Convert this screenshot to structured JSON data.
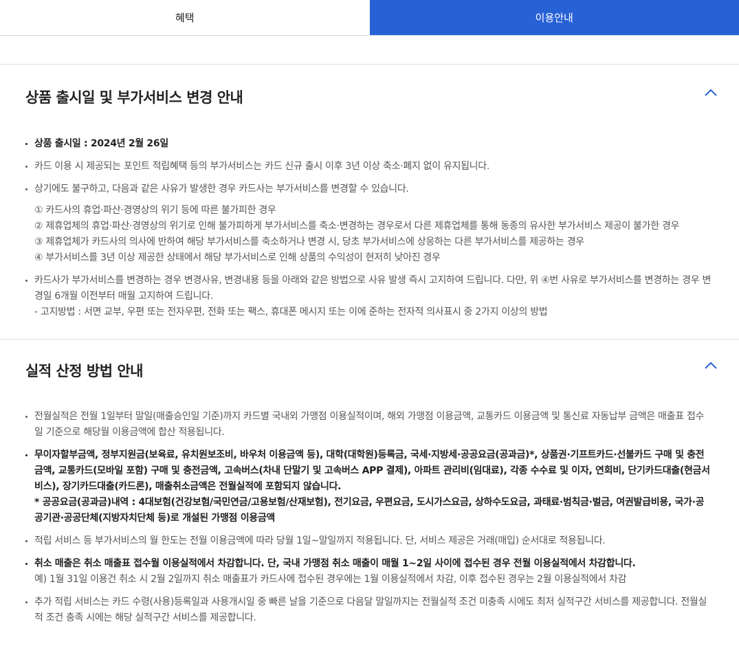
{
  "tabs": [
    {
      "label": "혜택",
      "active": false
    },
    {
      "label": "이용안내",
      "active": true
    }
  ],
  "colors": {
    "accent": "#2761d6",
    "chevron": "#2761d6"
  },
  "sections": [
    {
      "title": "상품 출시일 및 부가서비스 변경 안내",
      "toggle_icon": "chevron-up-icon",
      "items": [
        {
          "text": "상품 출시일 : 2024년 2월 26일"
        },
        {
          "text": "카드 이용 시 제공되는 포인트 적립혜택 등의 부가서비스는 카드 신규 출시 이후 3년 이상 축소·폐지 없이 유지됩니다."
        },
        {
          "text": "상기에도 불구하고, 다음과 같은 사유가 발생한 경우 카드사는 부가서비스를 변경할 수 있습니다.",
          "sub": [
            "① 카드사의 휴업·파산·경영상의 위기 등에 따른 불가피한 경우",
            "② 제휴업체의 휴업·파산·경영상의 위기로 인해 불가피하게 부가서비스를 축소·변경하는 경우로서 다른 제휴업체를 통해 동종의 유사한 부가서비스 제공이 불가한 경우",
            "③ 제휴업체가 카드사의 의사에 반하여 해당 부가서비스를 축소하거나 변경 시, 당초 부가서비스에 상응하는 다른 부가서비스를 제공하는 경우",
            "④ 부가서비스를 3년 이상 제공한 상태에서 해당 부가서비스로 인해 상품의 수익성이 현저히 낮아진 경우"
          ]
        },
        {
          "text": "카드사가 부가서비스를 변경하는 경우 변경사유, 변경내용 등을 아래와 같은 방법으로 사유 발생 즉시 고지하여 드립니다. 다만, 위 ④번 사유로 부가서비스를 변경하는 경우 변경일 6개월 이전부터 매월 고지하여 드립니다.",
          "note": "- 고지방법 : 서면 교부, 우편 또는 전자우편, 전화 또는 팩스, 휴대폰 메시지 또는 이에 준하는 전자적 의사표시 중 2가지 이상의 방법"
        }
      ]
    },
    {
      "title": "실적 산정 방법 안내",
      "toggle_icon": "chevron-up-icon",
      "items": [
        {
          "text": "전월실적은 전월 1일부터 말일(매출승인일 기준)까지 카드별 국내외 가맹점 이용실적이며, 해외 가맹점 이용금액, 교통카드 이용금액 및 통신료 자동납부 금액은 매출표 접수일 기준으로 해당월 이용금액에 합산 적용됩니다."
        },
        {
          "text": "무이자할부금액, 정부지원금(보육료, 유치원보조비, 바우처 이용금액 등), 대학(대학원)등록금, 국세·지방세·공공요금(공과금)*, 상품권·기프트카드·선불카드 구매 및 충전금액, 교통카드(모바일 포함) 구매 및 충전금액, 고속버스(차내 단말기 및 고속버스 APP 결제), 아파트 관리비(임대료), 각종 수수료 및 이자, 연회비, 단기카드대출(현금서비스), 장기카드대출(카드론), 매출취소금액은 전월실적에 포함되지 않습니다.",
          "strong": true,
          "note": "* 공공요금(공과금)내역 : 4대보험(건강보험/국민연금/고용보험/산재보험), 전기요금, 우편요금, 도시가스요금, 상하수도요금, 과태료·범칙금·벌금, 여권발급비용, 국가·공공기관·공공단체(지방자치단체 등)로 개설된 가맹점 이용금액"
        },
        {
          "text": "적립 서비스 등 부가서비스의 월 한도는 전월 이용금액에 따라 당월 1일~말일까지 적용됩니다. 단, 서비스 제공은 거래(매입) 순서대로 적용됩니다."
        },
        {
          "text": "취소 매출은 취소 매출표 접수월 이용실적에서 차감합니다. 단, 국내 가맹점 취소 매출이 매월 1~2일 사이에 접수된 경우 전월 이용실적에서 차감합니다.",
          "strong": true,
          "note_plain": "예) 1월 31일 이용건 취소 시 2월 2일까지 취소 매출표가 카드사에 접수된 경우에는 1월 이용실적에서 차감, 이후 접수된 경우는 2월 이용실적에서 차감"
        },
        {
          "text": "추가 적립 서비스는 카드 수령(사용)등록일과 사용개시일 중 빠른 날을 기준으로 다음달 말일까지는 전월실적 조건 미충족 시에도 최저 실적구간 서비스를 제공합니다. 전월실적 조건 충족 시에는 해당 실적구간 서비스를 제공합니다."
        }
      ]
    }
  ]
}
